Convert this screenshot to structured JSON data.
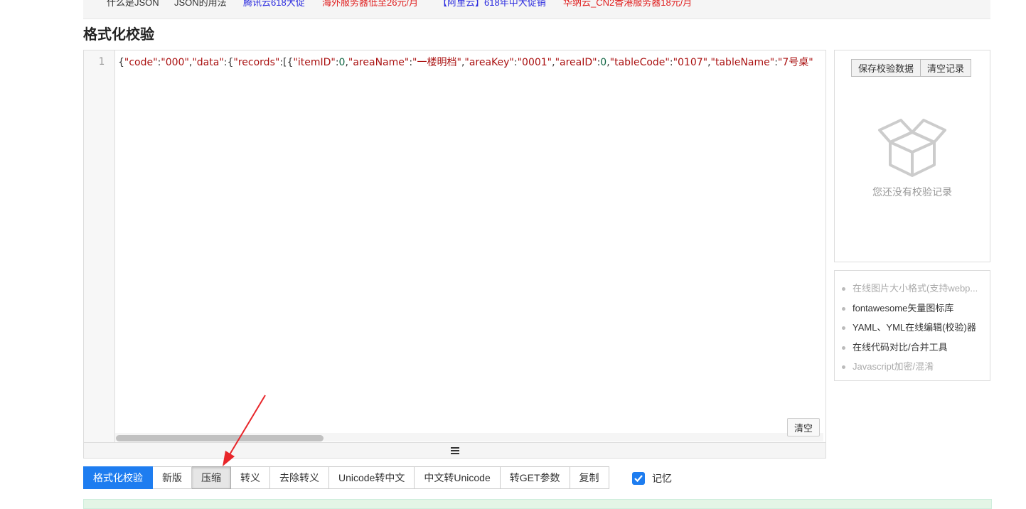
{
  "top_links": [
    {
      "text": "什么是JSON",
      "color": "#333333"
    },
    {
      "text": "JSON的用法",
      "color": "#333333"
    },
    {
      "text": "腾讯云618大促",
      "color": "#2a2adf"
    },
    {
      "text": "海外服务器低至26元/月",
      "color": "#e02020"
    },
    {
      "text": "【阿里云】618年中大促销",
      "color": "#2a2adf"
    },
    {
      "text": "华纳云_CN2香港服务器18元/月",
      "color": "#e02020"
    }
  ],
  "page_title": "格式化校验",
  "editor": {
    "line_number": "1",
    "code_tokens": [
      {
        "t": "{",
        "c": "p"
      },
      {
        "t": "\"code\"",
        "c": "k"
      },
      {
        "t": ":",
        "c": "p"
      },
      {
        "t": "\"000\"",
        "c": "s"
      },
      {
        "t": ",",
        "c": "p"
      },
      {
        "t": "\"data\"",
        "c": "k"
      },
      {
        "t": ":{",
        "c": "p"
      },
      {
        "t": "\"records\"",
        "c": "k"
      },
      {
        "t": ":[{",
        "c": "p"
      },
      {
        "t": "\"itemID\"",
        "c": "k"
      },
      {
        "t": ":",
        "c": "p"
      },
      {
        "t": "0",
        "c": "n"
      },
      {
        "t": ",",
        "c": "p"
      },
      {
        "t": "\"areaName\"",
        "c": "k"
      },
      {
        "t": ":",
        "c": "p"
      },
      {
        "t": "\"一楼明档\"",
        "c": "s"
      },
      {
        "t": ",",
        "c": "p"
      },
      {
        "t": "\"areaKey\"",
        "c": "k"
      },
      {
        "t": ":",
        "c": "p"
      },
      {
        "t": "\"0001\"",
        "c": "s"
      },
      {
        "t": ",",
        "c": "p"
      },
      {
        "t": "\"areaID\"",
        "c": "k"
      },
      {
        "t": ":",
        "c": "p"
      },
      {
        "t": "0",
        "c": "n"
      },
      {
        "t": ",",
        "c": "p"
      },
      {
        "t": "\"tableCode\"",
        "c": "k"
      },
      {
        "t": ":",
        "c": "p"
      },
      {
        "t": "\"0107\"",
        "c": "s"
      },
      {
        "t": ",",
        "c": "p"
      },
      {
        "t": "\"tableName\"",
        "c": "k"
      },
      {
        "t": ":",
        "c": "p"
      },
      {
        "t": "\"7号桌\"",
        "c": "s"
      }
    ],
    "clear_label": "清空"
  },
  "history": {
    "save_label": "保存校验数据",
    "clear_label": "清空记录",
    "empty_text": "您还没有校验记录"
  },
  "related_links": [
    {
      "text": "在线图片大小格式(支持webp...",
      "tone": "gray"
    },
    {
      "text": "fontawesome矢量图标库",
      "tone": "dark"
    },
    {
      "text": "YAML、YML在线编辑(校验)器",
      "tone": "dark"
    },
    {
      "text": "在线代码对比/合并工具",
      "tone": "dark"
    },
    {
      "text": "Javascript加密/混淆",
      "tone": "gray"
    }
  ],
  "toolbar": {
    "buttons": [
      {
        "label": "格式化校验",
        "state": "primary"
      },
      {
        "label": "新版",
        "state": "normal"
      },
      {
        "label": "压缩",
        "state": "active"
      },
      {
        "label": "转义",
        "state": "normal"
      },
      {
        "label": "去除转义",
        "state": "normal"
      },
      {
        "label": "Unicode转中文",
        "state": "normal"
      },
      {
        "label": "中文转Unicode",
        "state": "normal"
      },
      {
        "label": "转GET参数",
        "state": "normal"
      },
      {
        "label": "复制",
        "state": "normal"
      }
    ],
    "remember_label": "记忆",
    "remember_checked": true
  },
  "colors": {
    "primary": "#1e7df0",
    "annotation_arrow": "#e8262a"
  }
}
